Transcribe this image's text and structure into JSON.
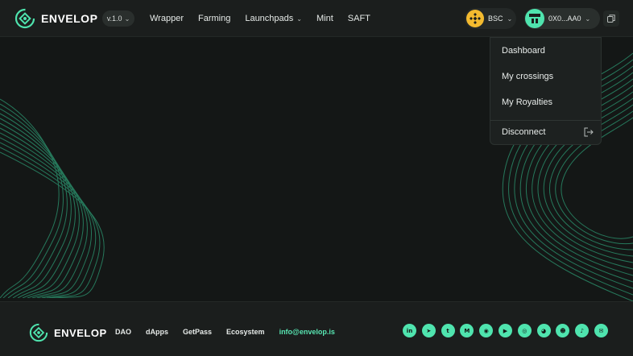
{
  "header": {
    "logo_text": "ENVELOP",
    "version": "v.1.0",
    "nav": [
      {
        "label": "Wrapper",
        "has_menu": false
      },
      {
        "label": "Farming",
        "has_menu": false
      },
      {
        "label": "Launchpads",
        "has_menu": true
      },
      {
        "label": "Mint",
        "has_menu": false
      },
      {
        "label": "SAFT",
        "has_menu": false
      }
    ],
    "network": {
      "label": "BSC",
      "icon": "bnb-icon",
      "color": "#f3ba2f"
    },
    "wallet": {
      "address": "0X0...AA0",
      "icon": "avatar-icon"
    },
    "copy_icon": "copy-icon"
  },
  "account_menu": {
    "items": [
      "Dashboard",
      "My crossings",
      "My Royalties"
    ],
    "disconnect": "Disconnect"
  },
  "footer": {
    "logo_text": "ENVELOP",
    "links": [
      "DAO",
      "dApps",
      "GetPass",
      "Ecosystem"
    ],
    "email": "info@envelop.is",
    "socials": [
      {
        "name": "linkedin-icon",
        "glyph": "in"
      },
      {
        "name": "telegram-icon",
        "glyph": "➤"
      },
      {
        "name": "twitter-icon",
        "glyph": "t"
      },
      {
        "name": "medium-icon",
        "glyph": "M"
      },
      {
        "name": "github-icon",
        "glyph": "◉"
      },
      {
        "name": "youtube-icon",
        "glyph": "▶"
      },
      {
        "name": "instagram-icon",
        "glyph": "◎"
      },
      {
        "name": "discord-icon",
        "glyph": "◕"
      },
      {
        "name": "reddit-icon",
        "glyph": "☻"
      },
      {
        "name": "tiktok-icon",
        "glyph": "♪"
      },
      {
        "name": "chat-icon",
        "glyph": "✉"
      }
    ]
  },
  "colors": {
    "accent": "#4fe4ae",
    "background": "#141716",
    "panel": "#1b1e1d"
  }
}
